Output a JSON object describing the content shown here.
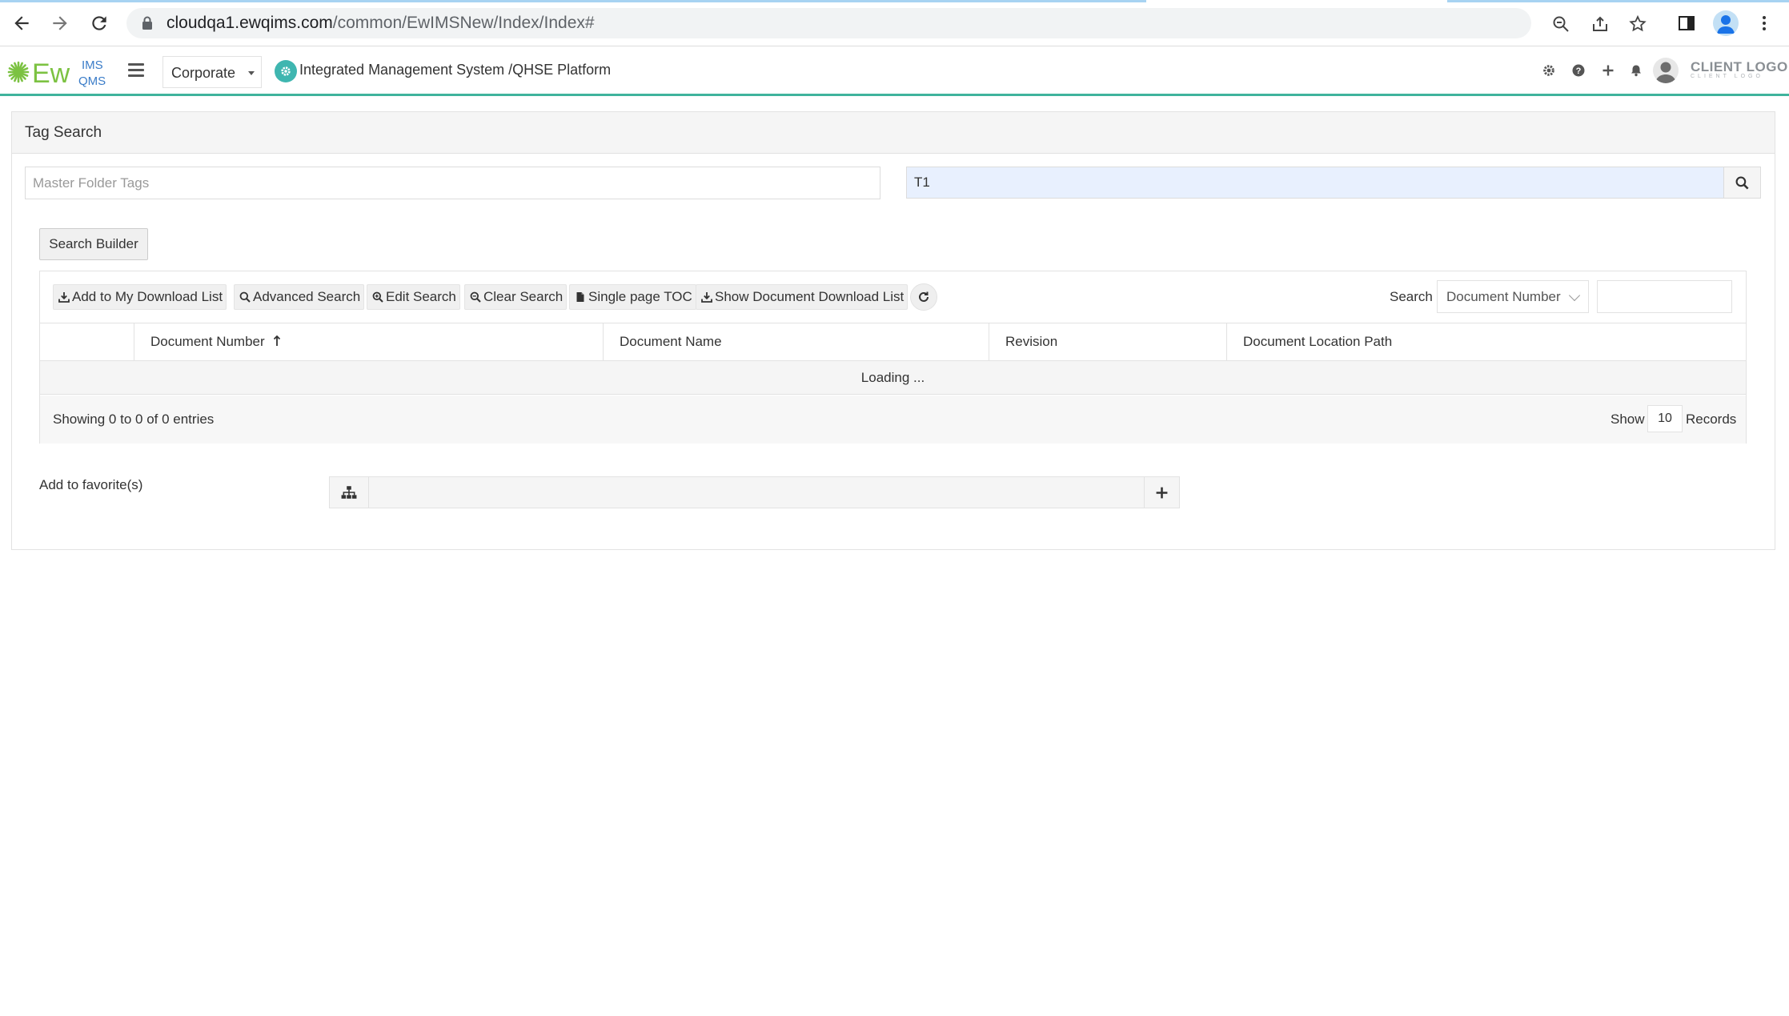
{
  "browser": {
    "url_host": "cloudqa1.ewqims.com",
    "url_path": "/common/EwIMSNew/Index/Index#"
  },
  "header": {
    "logo_text": "EwIMS QMS",
    "corporate_select": "Corporate",
    "platform_title": "Integrated Management System /QHSE Platform",
    "client_logo": "CLIENT LOGO",
    "client_logo_sub": "CLIENT LOGO"
  },
  "panel": {
    "title": "Tag Search",
    "tags_placeholder": "Master Folder Tags",
    "search_value": "T1",
    "search_builder_label": "Search Builder"
  },
  "toolbar": {
    "buttons": [
      {
        "label": "Add to My Download List",
        "icon": "download-icon"
      },
      {
        "label": "Advanced Search",
        "icon": "search-icon"
      },
      {
        "label": "Edit Search",
        "icon": "zoom-in-icon"
      },
      {
        "label": "Clear Search",
        "icon": "zoom-out-icon"
      },
      {
        "label": "Single page TOC",
        "icon": "file-icon"
      },
      {
        "label": "Show Document Download List",
        "icon": "download-icon"
      }
    ],
    "search_label": "Search",
    "search_field": "Document Number"
  },
  "table": {
    "columns": [
      "",
      "Document Number",
      "Document Name",
      "Revision",
      "Document Location Path"
    ],
    "loading_text": "Loading ...",
    "showing_text": "Showing 0 to 0 of 0 entries",
    "show_label": "Show",
    "page_size": "10",
    "records_label": "Records"
  },
  "favorites": {
    "label": "Add to favorite(s)"
  },
  "colors": {
    "accent": "#3fb39c",
    "search_bg": "#e8f0fe"
  }
}
